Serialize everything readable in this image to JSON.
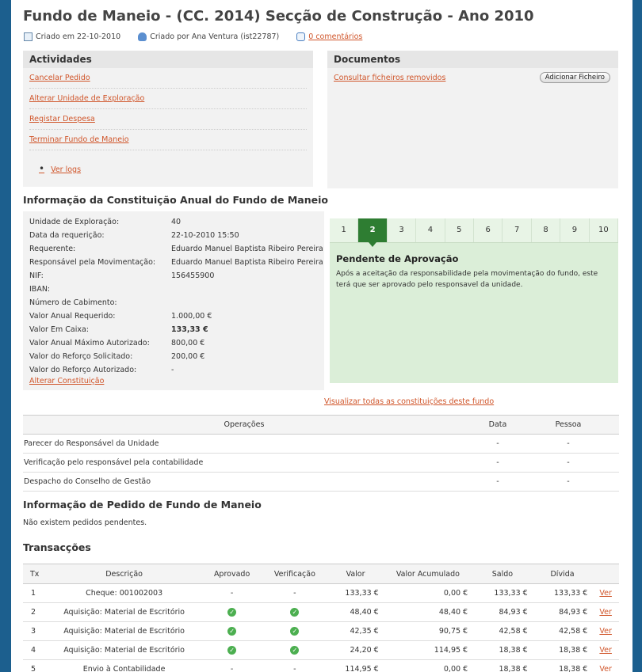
{
  "title": "Fundo de Maneio - (CC. 2014) Secção de Construção - Ano 2010",
  "meta": {
    "created_on": "Criado em 22-10-2010",
    "created_by": "Criado por Ana Ventura (ist22787)",
    "comments": "0 comentários"
  },
  "actividades": {
    "title": "Actividades",
    "items": [
      "Cancelar Pedido",
      "Alterar Unidade de Exploração",
      "Registar Despesa",
      "Terminar Fundo de Maneio"
    ],
    "bullet": "Ver logs"
  },
  "documentos": {
    "title": "Documentos",
    "link": "Consultar ficheiros removidos",
    "button": "Adicionar Ficheiro"
  },
  "constituicao": {
    "heading": "Informação da Constituição Anual do Fundo de Maneio",
    "rows": [
      {
        "label": "Unidade de Exploração:",
        "value": "40"
      },
      {
        "label": "Data da requerição:",
        "value": "22-10-2010 15:50"
      },
      {
        "label": "Requerente:",
        "value": "Eduardo Manuel Baptista Ribeiro Pereira"
      },
      {
        "label": "Responsável pela Movimentação:",
        "value": "Eduardo Manuel Baptista Ribeiro Pereira"
      },
      {
        "label": "NIF:",
        "value": "156455900"
      },
      {
        "label": "IBAN:",
        "value": ""
      },
      {
        "label": "Número de Cabimento:",
        "value": ""
      },
      {
        "label": "Valor Anual Requerido:",
        "value": "1.000,00 €"
      },
      {
        "label": "Valor Em Caixa:",
        "value": "133,33 €"
      },
      {
        "label": "Valor Anual Máximo Autorizado:",
        "value": "800,00 €"
      },
      {
        "label": "Valor do Reforço Solicitado:",
        "value": "200,00 €"
      },
      {
        "label": "Valor do Reforço Autorizado:",
        "value": "-"
      }
    ],
    "alter_link": "Alterar Constituição",
    "view_all": "Visualizar todas as constituições deste fundo"
  },
  "steps": {
    "tabs": [
      "1",
      "2",
      "3",
      "4",
      "5",
      "6",
      "7",
      "8",
      "9",
      "10"
    ],
    "active": 1,
    "title": "Pendente de Aprovação",
    "description": "Após a aceitação da responsabilidade pela movimentação do fundo, este terá que ser aprovado pelo responsavel da unidade."
  },
  "operacoes": {
    "headers": [
      "Operações",
      "Data",
      "Pessoa"
    ],
    "rows": [
      [
        "Parecer do Responsável da Unidade",
        "-",
        "-"
      ],
      [
        "Verificação pelo responsável pela contabilidade",
        "-",
        "-"
      ],
      [
        "Despacho do Conselho de Gestão",
        "-",
        "-"
      ]
    ]
  },
  "pedido": {
    "heading": "Informação de Pedido de Fundo de Maneio",
    "text": "Não existem pedidos pendentes."
  },
  "transaccoes": {
    "heading": "Transacções",
    "headers": [
      "Tx",
      "Descrição",
      "Aprovado",
      "Verificação",
      "Valor",
      "Valor Acumulado",
      "Saldo",
      "Dívida",
      ""
    ],
    "rows": [
      {
        "tx": "1",
        "desc": "Cheque: 001002003",
        "aprov": "-",
        "verif": "-",
        "valor": "133,33 €",
        "acum": "0,00 €",
        "saldo": "133,33 €",
        "divida": "133,33 €",
        "link": "Ver"
      },
      {
        "tx": "2",
        "desc": "Aquisição: Material de Escritório",
        "aprov": "ok",
        "verif": "ok",
        "valor": "48,40 €",
        "acum": "48,40 €",
        "saldo": "84,93 €",
        "divida": "84,93 €",
        "link": "Ver"
      },
      {
        "tx": "3",
        "desc": "Aquisição: Material de Escritório",
        "aprov": "ok",
        "verif": "ok",
        "valor": "42,35 €",
        "acum": "90,75 €",
        "saldo": "42,58 €",
        "divida": "42,58 €",
        "link": "Ver"
      },
      {
        "tx": "4",
        "desc": "Aquisição: Material de Escritório",
        "aprov": "ok",
        "verif": "ok",
        "valor": "24,20 €",
        "acum": "114,95 €",
        "saldo": "18,38 €",
        "divida": "18,38 €",
        "link": "Ver"
      },
      {
        "tx": "5",
        "desc": "Envio à Contabilidade",
        "aprov": "-",
        "verif": "-",
        "valor": "114,95 €",
        "acum": "0,00 €",
        "saldo": "18,38 €",
        "divida": "18,38 €",
        "link": "Ver"
      }
    ]
  },
  "colors": {
    "link": "#d0552a",
    "active_step": "#2e7d32",
    "step_bg": "#dbeed8",
    "panel_bg": "#f2f2f2"
  }
}
